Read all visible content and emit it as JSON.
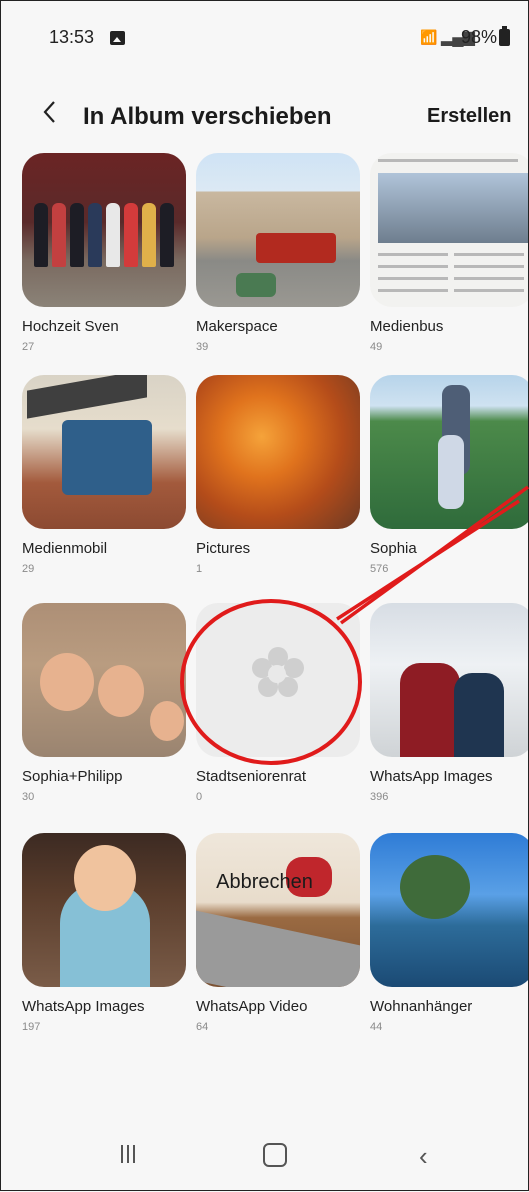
{
  "status": {
    "time": "13:53",
    "battery": "98%"
  },
  "header": {
    "title": "In Album verschieben",
    "create": "Erstellen"
  },
  "albums": [
    {
      "name": "Hochzeit Sven",
      "count": "27"
    },
    {
      "name": "Makerspace",
      "count": "39"
    },
    {
      "name": "Medienbus",
      "count": "49"
    },
    {
      "name": "Medienmobil",
      "count": "29"
    },
    {
      "name": "Pictures",
      "count": "1"
    },
    {
      "name": "Sophia",
      "count": "576"
    },
    {
      "name": "Sophia+Philipp",
      "count": "30"
    },
    {
      "name": "Stadtseniorenrat",
      "count": "0"
    },
    {
      "name": "WhatsApp Images",
      "count": "396"
    },
    {
      "name": "WhatsApp Images",
      "count": "197"
    },
    {
      "name": "WhatsApp Video",
      "count": "64"
    },
    {
      "name": "Wohnanhänger",
      "count": "44"
    }
  ],
  "footer": {
    "cancel": "Abbrechen"
  },
  "annotation_color": "#e01b1b"
}
